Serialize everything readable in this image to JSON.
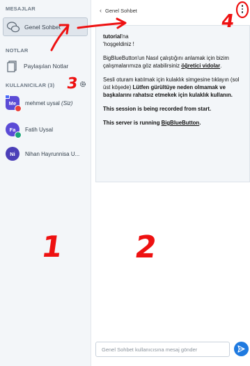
{
  "sidebar": {
    "messages_title": "MESAJLAR",
    "public_chat_label": "Genel Sohbet",
    "notes_title": "NOTLAR",
    "shared_notes_label": "Paylaşılan Notlar",
    "users_title": "KULLANICILAR (3)",
    "users": [
      {
        "initials": "Me",
        "name": "mehmet uysal",
        "suffix": "(Siz)",
        "color": "#5b4bd6",
        "badge_color": "#e8413a",
        "presenter": true,
        "shape": "square"
      },
      {
        "initials": "Fa",
        "name": "Fatih Uysal",
        "suffix": "",
        "color": "#5b4bd6",
        "badge_color": "#1aa57a",
        "presenter": false,
        "shape": "round"
      },
      {
        "initials": "Ni",
        "name": "Nihan Hayrunnisa U...",
        "suffix": "",
        "color": "#4b3fb8",
        "badge_color": "",
        "presenter": false,
        "shape": "round"
      }
    ]
  },
  "chat": {
    "header_title": "Genel Sohbet",
    "welcome": {
      "line1_bold": "tutorial",
      "line1_rest": "'na",
      "line2": "'hoşgeldiniz !",
      "para2_text": "BigBlueButton'un Nasıl çalıştığını anlamak için bizim çalışmalarımıza göz atabilirsiniz ",
      "para2_link": "öğretici vidolar",
      "para2_end": ".",
      "para3_text": "Sesli oturam katılmak için kulaklık simgesine tıklayın (sol üst köşede) ",
      "para3_bold": "Lütfen gürültüye neden olmamak ve başkalarını rahatsız etmekek için kulaklık kullanın.",
      "para4": "This session is being recorded from start.",
      "para5_text": "This server is running ",
      "para5_link": "BigBlueButton",
      "para5_end": "."
    },
    "input_placeholder": "Genel Sohbet kullanıcısına mesaj gönder"
  },
  "annotations": {
    "n1": "1",
    "n2": "2",
    "n3": "3",
    "n4": "4",
    "color": "#ee1111"
  }
}
